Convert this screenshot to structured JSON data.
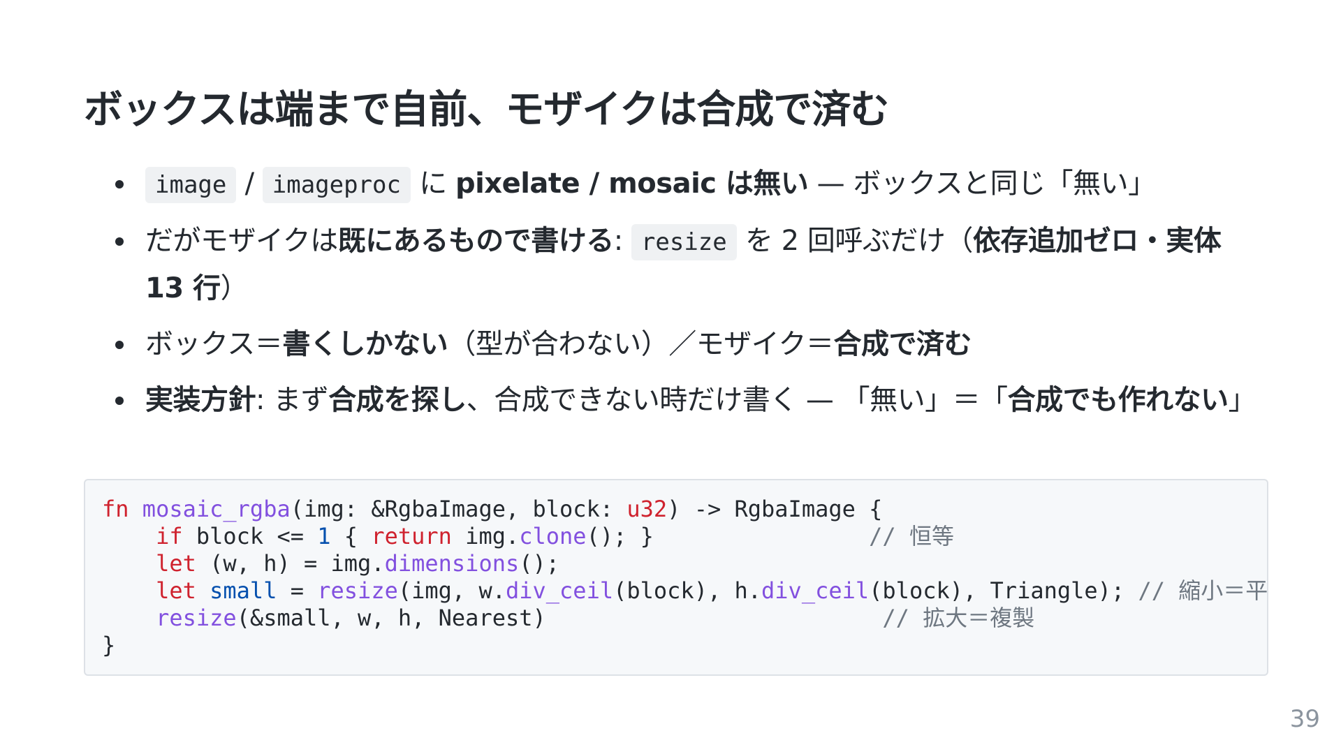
{
  "slide": {
    "title": "ボックスは端まで自前、モザイクは合成で済む",
    "page_number": "39"
  },
  "bullets": [
    {
      "code1": "image",
      "sep": " / ",
      "code2": "imageproc",
      "t1": " に ",
      "b1": "pixelate / mosaic は無い",
      "t2": " — ボックスと同じ「無い」"
    },
    {
      "t1": "だがモザイクは",
      "b1": "既にあるもので書ける",
      "t2": ": ",
      "code1": "resize",
      "t3": " を 2 回呼ぶだけ（",
      "b2": "依存追加ゼロ・実体 13 行",
      "t4": "）"
    },
    {
      "t1": "ボックス＝",
      "b1": "書くしかない",
      "t2": "（型が合わない）／モザイク＝",
      "b2": "合成で済む"
    },
    {
      "b1": "実装方針",
      "t1": ": まず",
      "b2": "合成を探し",
      "t2": "、合成できない時だけ書く — 「無い」＝「",
      "b3": "合成でも作れない",
      "t3": "」"
    }
  ],
  "code": {
    "l1": {
      "fn": "fn",
      "name": "mosaic_rgba",
      "p1": "(img: &RgbaImage, block: ",
      "type": "u32",
      "p2": ") -> RgbaImage {"
    },
    "l2": {
      "indent": "    ",
      "kw_if": "if",
      "p1": " block <= ",
      "num": "1",
      "p2": " { ",
      "kw_ret": "return",
      "p3": " img.",
      "clone": "clone",
      "p4": "(); }                ",
      "comment": "// 恒等"
    },
    "l3": {
      "indent": "    ",
      "kw_let": "let",
      "p1": " (w, h) = img.",
      "dims": "dimensions",
      "p2": "();"
    },
    "l4": {
      "indent": "    ",
      "kw_let": "let",
      "p0": " ",
      "var": "small",
      "p1": " = ",
      "resize": "resize",
      "p2": "(img, w.",
      "div1": "div_ceil",
      "p3": "(block), h.",
      "div2": "div_ceil",
      "p4": "(block), Triangle); ",
      "comment": "// 縮小＝平均"
    },
    "l5": {
      "indent": "    ",
      "resize": "resize",
      "p1": "(&small, w, h, Nearest)                         ",
      "comment": "// 拡大＝複製"
    },
    "l6": {
      "p1": "}"
    }
  }
}
